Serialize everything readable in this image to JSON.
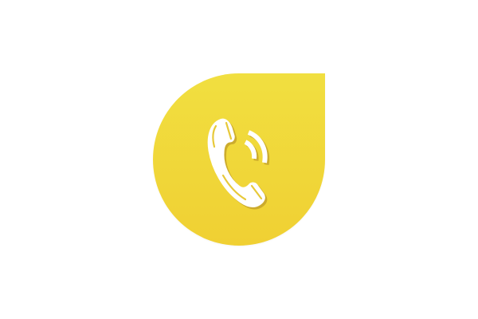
{
  "app_icon": {
    "icon": "phone-call-icon",
    "background_color": "#f0d63a",
    "glyph_color": "#ffffff",
    "glyph_shadow_color": "#c9a82a"
  }
}
